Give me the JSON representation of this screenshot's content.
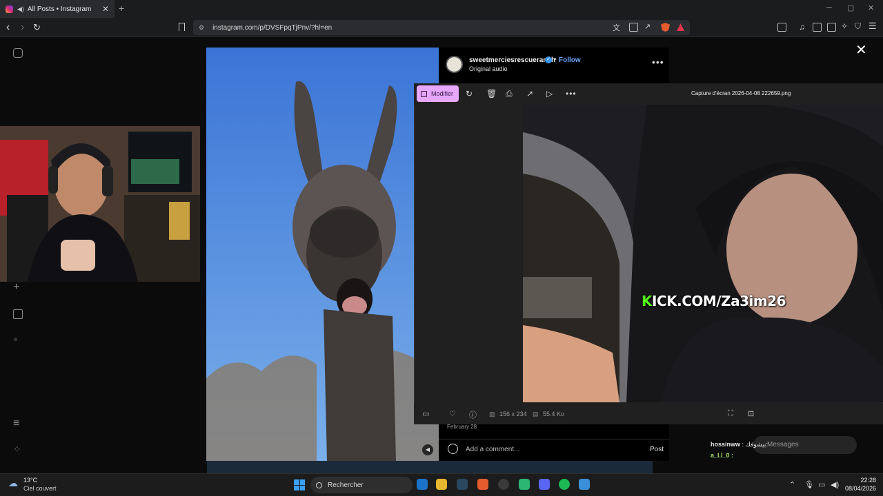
{
  "browser": {
    "tab_title": "All Posts • Instagram",
    "new_tab": "+",
    "url": "instagram.com/p/DVSFpqTjPnv/?hl=en"
  },
  "post": {
    "username": "sweetmerciesrescueranch",
    "follow": "Follow",
    "audio": "Original audio",
    "date": "February 28",
    "comment_placeholder": "Add a comment...",
    "post_button": "Post"
  },
  "viewer": {
    "edit_button": "Modifier",
    "filename": "Capture d'écran 2026-04-08 222659.png",
    "dimensions": "156 x 234",
    "file_size": "55.4 Ko"
  },
  "overlay": {
    "kick_text": "KICK.COM/Za3im26",
    "chat_user1": "hossinww",
    "chat_msg1": "بيشوفك:",
    "chat_user2": "a_l.l_0 :",
    "messages_label": "Messages"
  },
  "taskbar": {
    "temperature": "13°C",
    "weather": "Ciel couvert",
    "search_label": "Rechercher",
    "time": "22:28",
    "date": "08/04/2026"
  }
}
